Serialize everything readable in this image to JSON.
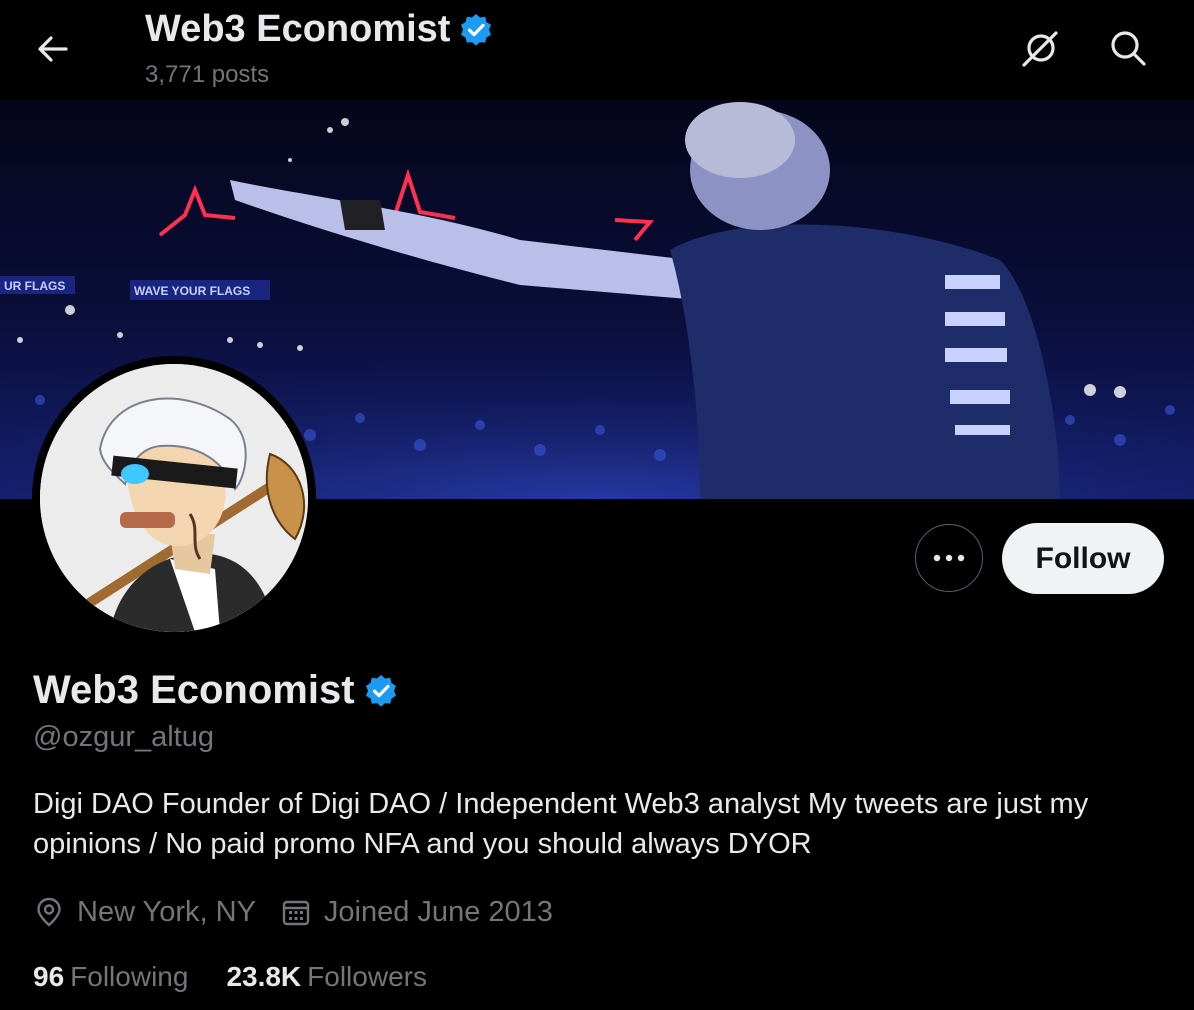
{
  "header": {
    "title": "Web3 Economist",
    "posts_count": "3,771 posts",
    "back_icon": "arrow-left-icon",
    "grok_icon": "grok-icon",
    "search_icon": "search-icon"
  },
  "profile": {
    "display_name": "Web3 Economist",
    "verified": true,
    "handle": "@ozgur_altug",
    "bio": "Digi DAO Founder of Digi DAO / Independent Web3 analyst My tweets are just my opinions / No paid promo NFA and you should always DYOR",
    "location": "New York, NY",
    "joined": "Joined June 2013",
    "following_count": "96",
    "following_label": "Following",
    "followers_count": "23.8K",
    "followers_label": "Followers"
  },
  "actions": {
    "follow_label": "Follow",
    "more_icon": "more-horizontal-icon"
  },
  "colors": {
    "background": "#000000",
    "verified_blue": "#1d9bf0",
    "muted_text": "#71767b",
    "follow_button_bg": "#eff3f4"
  }
}
